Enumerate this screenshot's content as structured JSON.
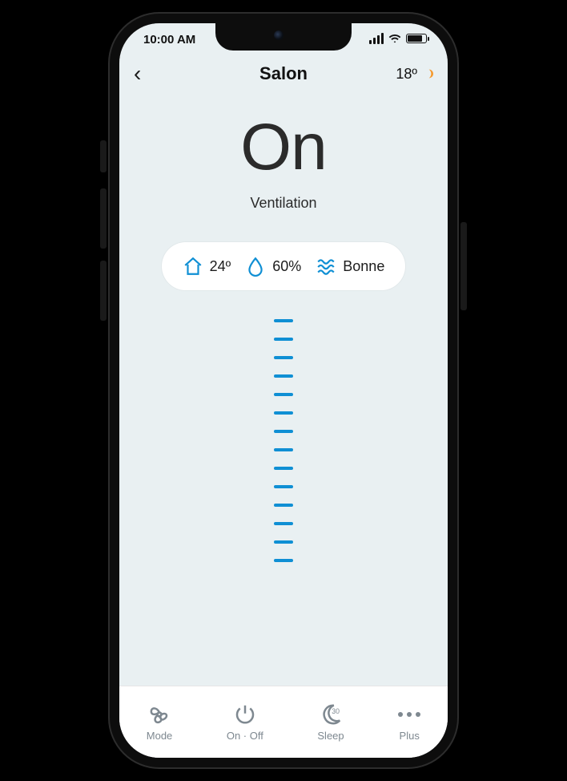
{
  "status": {
    "time": "10:00 AM"
  },
  "header": {
    "room": "Salon",
    "outside_temp": "18º"
  },
  "main": {
    "state": "On",
    "subtitle": "Ventilation"
  },
  "readings": {
    "indoor_temp": "24º",
    "humidity": "60%",
    "air_quality": "Bonne"
  },
  "ticks": {
    "count": 14
  },
  "bottom": {
    "mode": "Mode",
    "onoff": "On · Off",
    "sleep": "Sleep",
    "sleep_badge": "30",
    "plus": "Plus"
  },
  "colors": {
    "accent": "#0f8fd4"
  }
}
